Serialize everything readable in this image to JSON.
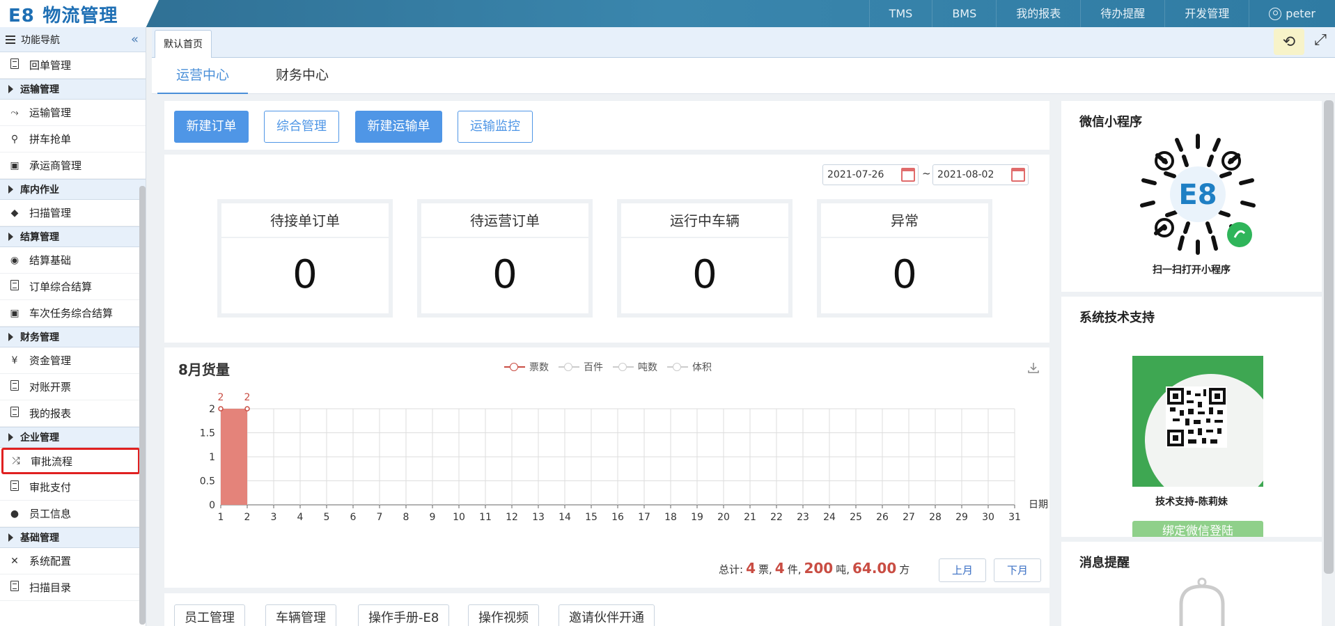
{
  "header": {
    "logo_mark": "E8",
    "logo_text": "物流管理",
    "nav": [
      "TMS",
      "BMS",
      "我的报表",
      "待办提醒",
      "开发管理"
    ],
    "user": "peter"
  },
  "sidebar": {
    "title": "功能导航",
    "collapse_icon": "«",
    "sections": [
      {
        "type": "item",
        "label": "回单管理",
        "icon": "doc-icon"
      },
      {
        "type": "group",
        "label": "运输管理"
      },
      {
        "type": "item",
        "label": "运输管理",
        "icon": "route-icon"
      },
      {
        "type": "item",
        "label": "拼车抢单",
        "icon": "pin-icon"
      },
      {
        "type": "item",
        "label": "承运商管理",
        "icon": "bus-icon"
      },
      {
        "type": "group",
        "label": "库内作业"
      },
      {
        "type": "item",
        "label": "扫描管理",
        "icon": "box-icon"
      },
      {
        "type": "group",
        "label": "结算管理"
      },
      {
        "type": "item",
        "label": "结算基础",
        "icon": "eye-icon"
      },
      {
        "type": "item",
        "label": "订单综合结算",
        "icon": "doc-icon"
      },
      {
        "type": "item",
        "label": "车次任务综合结算",
        "icon": "bus-icon"
      },
      {
        "type": "group",
        "label": "财务管理"
      },
      {
        "type": "item",
        "label": "资金管理",
        "icon": "yen-icon"
      },
      {
        "type": "item",
        "label": "对账开票",
        "icon": "doc-icon"
      },
      {
        "type": "item",
        "label": "我的报表",
        "icon": "doc-icon"
      },
      {
        "type": "group",
        "label": "企业管理"
      },
      {
        "type": "item",
        "label": "审批流程",
        "icon": "shuffle-icon",
        "highlight": true
      },
      {
        "type": "item",
        "label": "审批支付",
        "icon": "doc-icon"
      },
      {
        "type": "item",
        "label": "员工信息",
        "icon": "user-icon"
      },
      {
        "type": "group",
        "label": "基础管理"
      },
      {
        "type": "item",
        "label": "系统配置",
        "icon": "tools-icon"
      },
      {
        "type": "item",
        "label": "扫描目录",
        "icon": "doc-icon"
      }
    ]
  },
  "tabs": {
    "active": "默认首页"
  },
  "subtabs": [
    "运营中心",
    "财务中心"
  ],
  "actions": [
    "新建订单",
    "综合管理",
    "新建运输单",
    "运输监控"
  ],
  "dates": {
    "start": "2021-07-26",
    "separator": "~",
    "end": "2021-08-02"
  },
  "stats": [
    {
      "title": "待接单订单",
      "value": "0"
    },
    {
      "title": "待运营订单",
      "value": "0"
    },
    {
      "title": "运行中车辆",
      "value": "0"
    },
    {
      "title": "异常",
      "value": "0"
    }
  ],
  "chart_data": {
    "type": "bar",
    "title": "8月货量",
    "xlabel": "日期",
    "ylabel": "",
    "ylim": [
      0,
      2
    ],
    "yticks": [
      "0",
      "0.5",
      "1",
      "1.5",
      "2"
    ],
    "x": [
      1,
      2,
      3,
      4,
      5,
      6,
      7,
      8,
      9,
      10,
      11,
      12,
      13,
      14,
      15,
      16,
      17,
      18,
      19,
      20,
      21,
      22,
      23,
      24,
      25,
      26,
      27,
      28,
      29,
      30,
      31
    ],
    "legend": [
      {
        "name": "票数",
        "active": true
      },
      {
        "name": "百件",
        "active": false
      },
      {
        "name": "吨数",
        "active": false
      },
      {
        "name": "体积",
        "active": false
      }
    ],
    "series": [
      {
        "name": "票数",
        "points": [
          {
            "x": 1,
            "y": 2
          },
          {
            "x": 2,
            "y": 2
          }
        ]
      }
    ],
    "color": "#e4837a"
  },
  "totals": {
    "prefix": "总计:",
    "tickets": "4",
    "tickets_unit": "票,",
    "pieces": "4",
    "pieces_unit": "件,",
    "tons": "200",
    "tons_unit": "吨,",
    "volume": "64.00",
    "volume_unit": "方"
  },
  "month_nav": {
    "prev": "上月",
    "next": "下月"
  },
  "bottom_tabs": [
    "员工管理",
    "车辆管理",
    "操作手册-E8",
    "操作视频",
    "邀请伙伴开通"
  ],
  "right": {
    "miniapp_title": "微信小程序",
    "miniapp_caption": "扫一扫打开小程序",
    "qr_logo": "E8",
    "support_title": "系统技术支持",
    "support_caption": "技术支持-陈莉妹",
    "bind_button": "绑定微信登陆",
    "messages_title": "消息提醒"
  }
}
